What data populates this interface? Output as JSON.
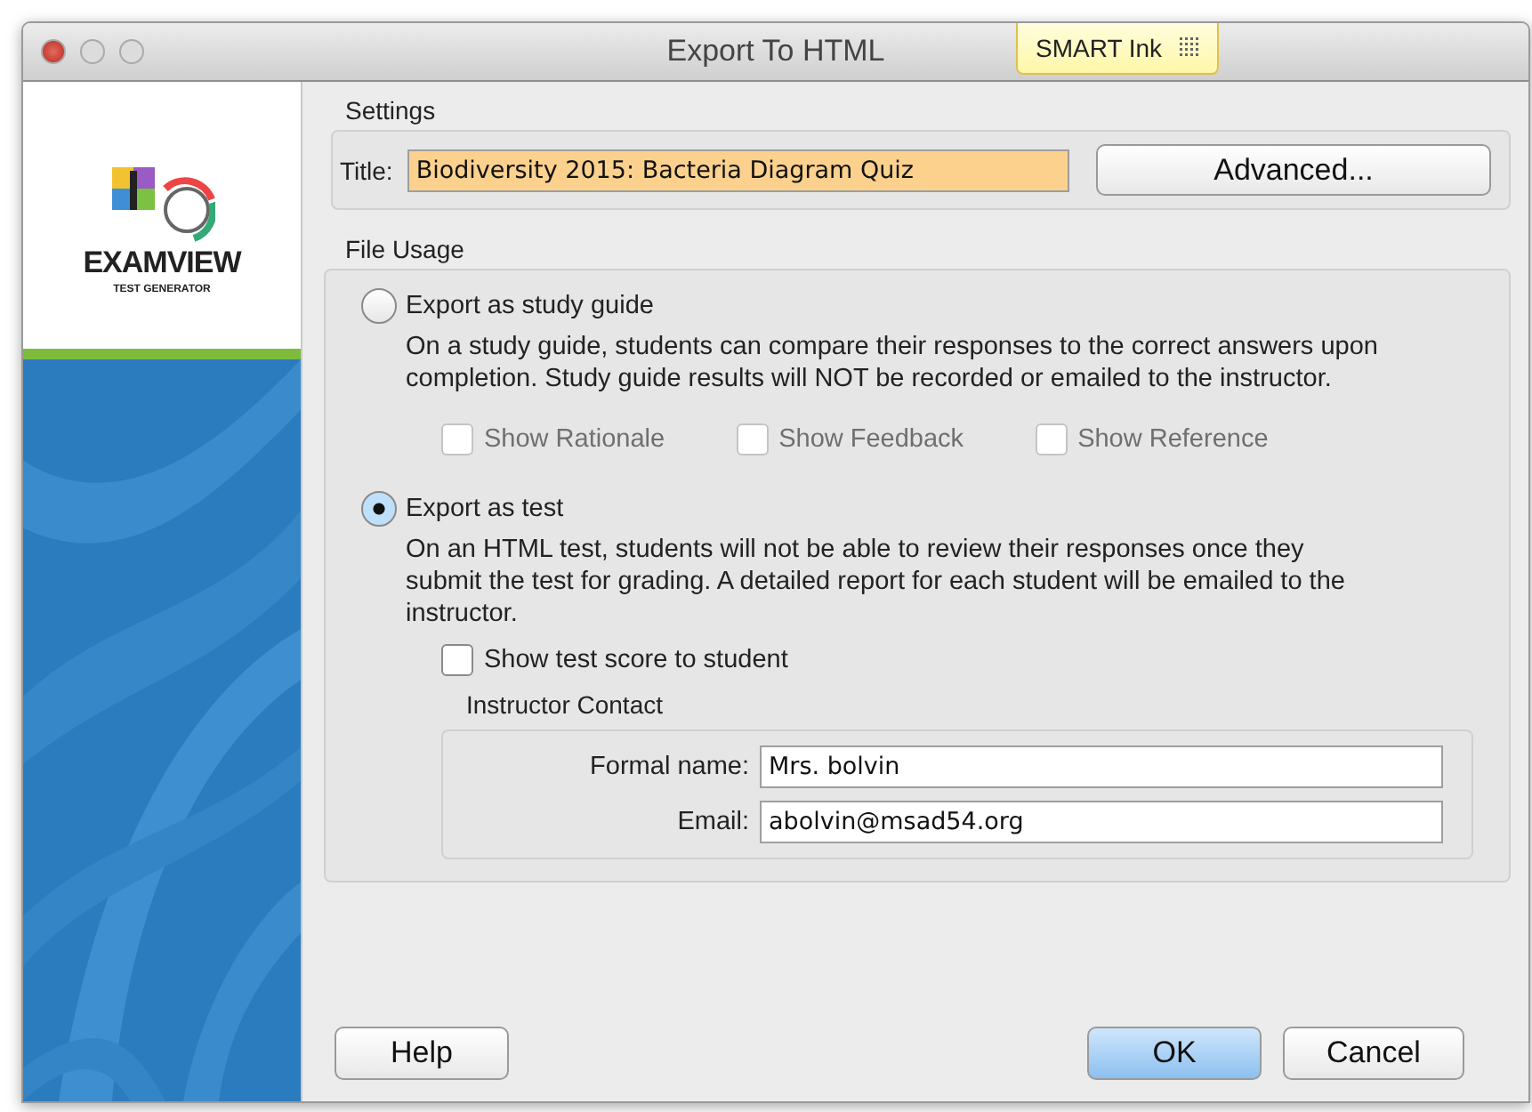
{
  "window": {
    "title": "Export To HTML"
  },
  "smart_ink": {
    "label": "SMART Ink"
  },
  "logo": {
    "name": "EXAMVIEW",
    "tagline": "TEST GENERATOR"
  },
  "settings": {
    "heading": "Settings",
    "title_label": "Title:",
    "title_value": "Biodiversity 2015: Bacteria Diagram Quiz",
    "advanced_button": "Advanced..."
  },
  "file_usage": {
    "heading": "File Usage",
    "options": [
      {
        "label": "Export as study guide",
        "selected": false,
        "description": "On a study guide, students can compare their responses to the correct answers upon completion.  Study guide results will NOT be recorded or emailed to the instructor.",
        "checkboxes": [
          {
            "label": "Show Rationale",
            "checked": false,
            "disabled": true
          },
          {
            "label": "Show Feedback",
            "checked": false,
            "disabled": true
          },
          {
            "label": "Show Reference",
            "checked": false,
            "disabled": true
          }
        ]
      },
      {
        "label": "Export as test",
        "selected": true,
        "description": "On an HTML test, students will not be able to review their responses once they submit the test for grading.  A detailed report for each student will be emailed to the instructor.",
        "checkboxes": [
          {
            "label": "Show test score to student",
            "checked": false,
            "disabled": false
          }
        ]
      }
    ],
    "contact": {
      "heading": "Instructor Contact",
      "fields": [
        {
          "label": "Formal name:",
          "value": "Mrs. bolvin"
        },
        {
          "label": "Email:",
          "value": "abolvin@msad54.org"
        }
      ]
    }
  },
  "buttons": [
    {
      "label": "Help",
      "kind": "secondary"
    },
    {
      "label": "OK",
      "kind": "default"
    },
    {
      "label": "Cancel",
      "kind": "secondary"
    }
  ]
}
